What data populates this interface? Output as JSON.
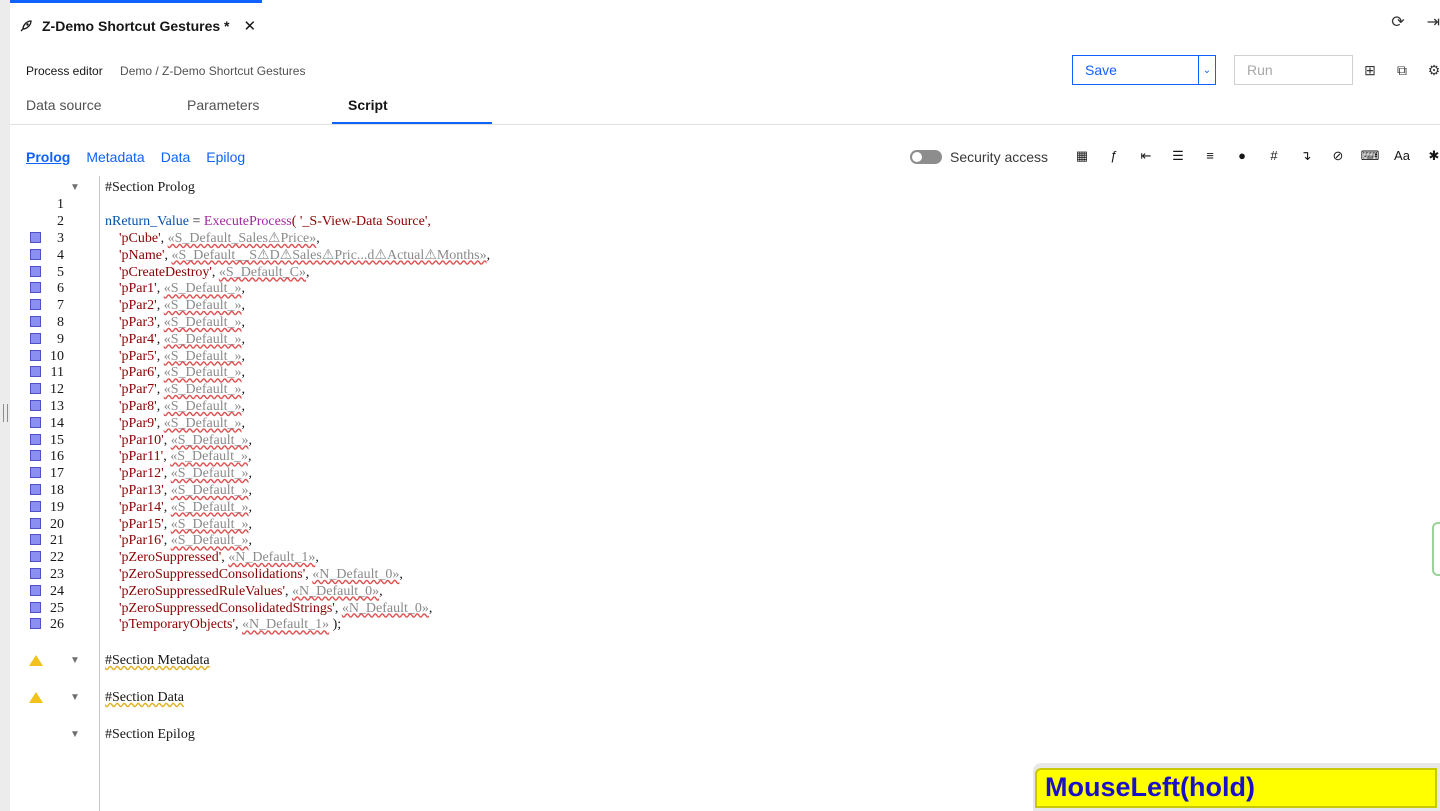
{
  "doc_tab": {
    "title": "Z-Demo Shortcut Gestures *",
    "close": "✕",
    "icon": "rocket-icon"
  },
  "header": {
    "label": "Process editor",
    "breadcrumb": "Demo / Z-Demo Shortcut Gestures"
  },
  "save": {
    "label": "Save"
  },
  "run": {
    "label": "Run"
  },
  "tabs": [
    "Data source",
    "Parameters",
    "Script"
  ],
  "section_links": [
    "Prolog",
    "Metadata",
    "Data",
    "Epilog"
  ],
  "security_label": "Security access",
  "code": {
    "section_prolog": "#Section Prolog",
    "line2": {
      "var": "nReturn_Value",
      "eq": " = ",
      "fn": "ExecuteProcess",
      "rest": "( '_S-View-Data Source',"
    },
    "params": [
      {
        "n": "3",
        "name": "'pCube'",
        "ph": "«S_Default_Sales⚠Price»"
      },
      {
        "n": "4",
        "name": "'pName'",
        "ph": "«S_Default__S⚠D⚠Sales⚠Pric...d⚠Actual⚠Months»"
      },
      {
        "n": "5",
        "name": "'pCreateDestroy'",
        "ph": "«S_Default_C»"
      },
      {
        "n": "6",
        "name": "'pPar1'",
        "ph": "«S_Default_»"
      },
      {
        "n": "7",
        "name": "'pPar2'",
        "ph": "«S_Default_»"
      },
      {
        "n": "8",
        "name": "'pPar3'",
        "ph": "«S_Default_»"
      },
      {
        "n": "9",
        "name": "'pPar4'",
        "ph": "«S_Default_»"
      },
      {
        "n": "10",
        "name": "'pPar5'",
        "ph": "«S_Default_»"
      },
      {
        "n": "11",
        "name": "'pPar6'",
        "ph": "«S_Default_»"
      },
      {
        "n": "12",
        "name": "'pPar7'",
        "ph": "«S_Default_»"
      },
      {
        "n": "13",
        "name": "'pPar8'",
        "ph": "«S_Default_»"
      },
      {
        "n": "14",
        "name": "'pPar9'",
        "ph": "«S_Default_»"
      },
      {
        "n": "15",
        "name": "'pPar10'",
        "ph": "«S_Default_»"
      },
      {
        "n": "16",
        "name": "'pPar11'",
        "ph": "«S_Default_»"
      },
      {
        "n": "17",
        "name": "'pPar12'",
        "ph": "«S_Default_»"
      },
      {
        "n": "18",
        "name": "'pPar13'",
        "ph": "«S_Default_»"
      },
      {
        "n": "19",
        "name": "'pPar14'",
        "ph": "«S_Default_»"
      },
      {
        "n": "20",
        "name": "'pPar15'",
        "ph": "«S_Default_»"
      },
      {
        "n": "21",
        "name": "'pPar16'",
        "ph": "«S_Default_»"
      },
      {
        "n": "22",
        "name": "'pZeroSuppressed'",
        "ph": "«N_Default_1»"
      },
      {
        "n": "23",
        "name": "'pZeroSuppressedConsolidations'",
        "ph": "«N_Default_0»"
      },
      {
        "n": "24",
        "name": "'pZeroSuppressedRuleValues'",
        "ph": "«N_Default_0»"
      },
      {
        "n": "25",
        "name": "'pZeroSuppressedConsolidatedStrings'",
        "ph": "«N_Default_0»"
      },
      {
        "n": "26",
        "name": "'pTemporaryObjects'",
        "ph": "«N_Default_1»",
        "end": " );"
      }
    ],
    "section_metadata": "#Section Metadata",
    "section_data": "#Section Data",
    "section_epilog": "#Section Epilog"
  },
  "overlay": "MouseLeft(hold)",
  "colors": {
    "accent": "#0f62fe",
    "overlay_bg": "#ffff00",
    "overlay_text": "#1a10c8"
  }
}
